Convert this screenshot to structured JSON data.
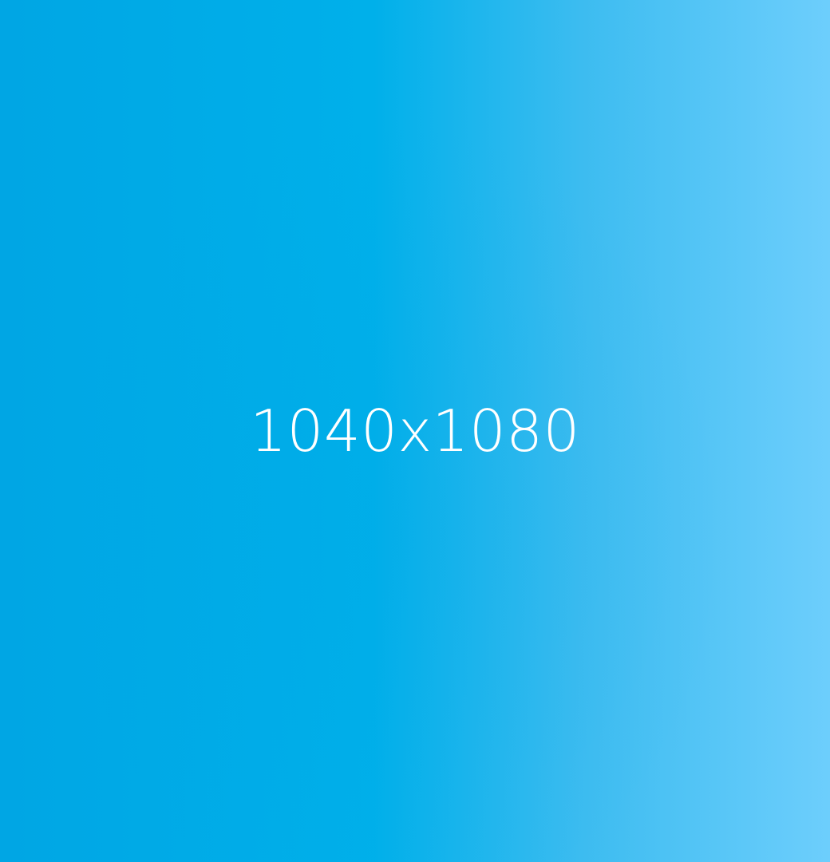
{
  "placeholder": {
    "label": "1040x1080",
    "colors": {
      "gradient_start": "#00a6e4",
      "gradient_end": "#6dcefc",
      "text": "#ffffff"
    }
  }
}
